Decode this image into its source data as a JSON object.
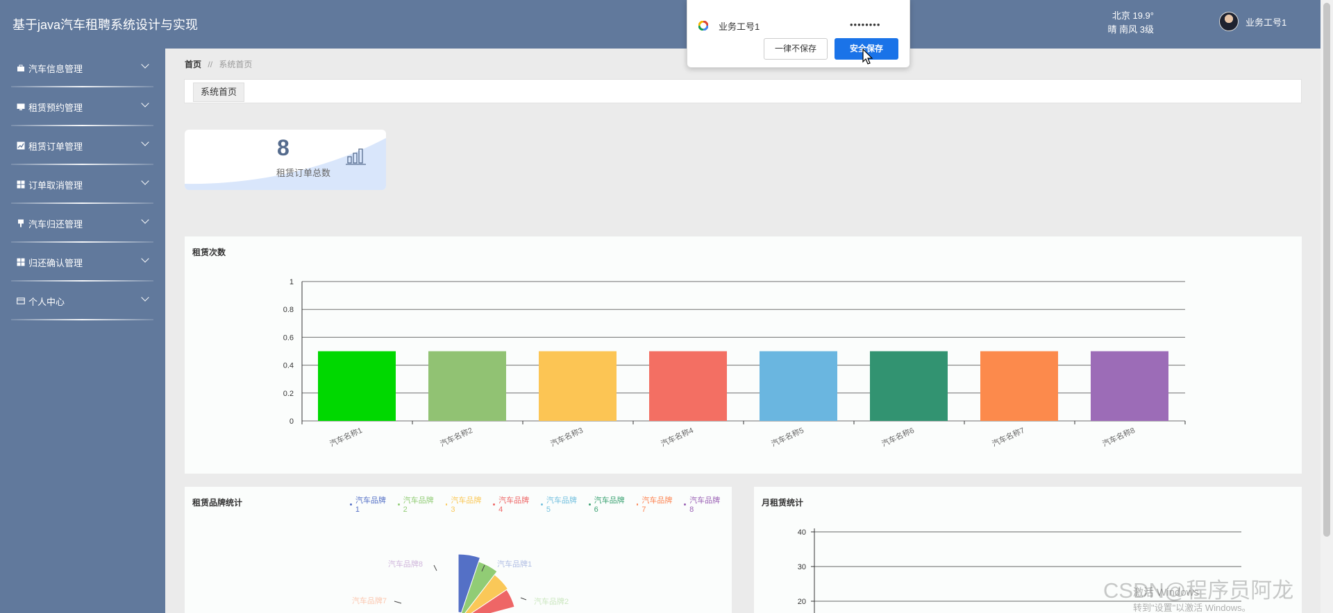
{
  "app": {
    "title": "基于java汽车租聘系统设计与实现",
    "weather_city_temp": "北京  19.9°",
    "weather_cond": "晴  南风  3级",
    "user_name": "业务工号1"
  },
  "sidebar": {
    "items": [
      {
        "label": "汽车信息管理",
        "icon": "briefcase-icon"
      },
      {
        "label": "租赁预约管理",
        "icon": "monitor-icon"
      },
      {
        "label": "租赁订单管理",
        "icon": "chart-icon"
      },
      {
        "label": "订单取消管理",
        "icon": "grid-icon"
      },
      {
        "label": "汽车归还管理",
        "icon": "pin-icon"
      },
      {
        "label": "归还确认管理",
        "icon": "grid-icon"
      },
      {
        "label": "个人中心",
        "icon": "card-icon"
      }
    ]
  },
  "breadcrumb": {
    "home": "首页",
    "sep": "//",
    "current": "系统首页"
  },
  "tabs": [
    {
      "label": "系统首页"
    }
  ],
  "stat_card": {
    "value": "8",
    "label": "租赁订单总数",
    "icon": "bar-chart-icon"
  },
  "panels": {
    "rent_count": {
      "title": "租赁次数"
    },
    "brand_stats": {
      "title": "租赁品牌统计"
    },
    "monthly": {
      "title": "月租赁统计"
    }
  },
  "chart_data": [
    {
      "type": "bar",
      "title": "租赁次数",
      "categories": [
        "汽车名称1",
        "汽车名称2",
        "汽车名称3",
        "汽车名称4",
        "汽车名称5",
        "汽车名称6",
        "汽车名称7",
        "汽车名称8"
      ],
      "values": [
        0.5,
        0.5,
        0.5,
        0.5,
        0.5,
        0.5,
        0.5,
        0.5
      ],
      "colors": [
        "#00d800",
        "#91c273",
        "#fcc554",
        "#f36f63",
        "#6ab6e0",
        "#329371",
        "#fc8a4c",
        "#9c6cb7"
      ],
      "ylim": [
        0,
        1
      ],
      "yticks": [
        "0",
        "0.2",
        "0.4",
        "0.6",
        "0.8",
        "1"
      ],
      "grid": true
    },
    {
      "type": "pie",
      "title": "租赁品牌统计",
      "legend": [
        "汽车品牌1",
        "汽车品牌2",
        "汽车品牌3",
        "汽车品牌4",
        "汽车品牌5",
        "汽车品牌6",
        "汽车品牌7",
        "汽车品牌8"
      ],
      "colors": [
        "#5470c6",
        "#91cc75",
        "#fac858",
        "#ee6666",
        "#73c0de",
        "#3ba272",
        "#fc8452",
        "#9a60b4"
      ],
      "visible_slice_labels": [
        "汽车品牌1",
        "汽车品牌2",
        "汽车品牌7",
        "汽车品牌8"
      ],
      "legend_position": "top-right"
    },
    {
      "type": "line",
      "title": "月租赁统计",
      "yticks": [
        "40",
        "30",
        "20"
      ],
      "grid": true
    }
  ],
  "save_popup": {
    "username": "业务工号1",
    "password_mask": "••••••••",
    "never_label": "一律不保存",
    "save_label": "安全保存"
  },
  "overlay": {
    "watermark": "CSDN@程序员阿龙",
    "activate_line1": "激活 Windows",
    "activate_line2": "转到\"设置\"以激活 Windows。"
  }
}
